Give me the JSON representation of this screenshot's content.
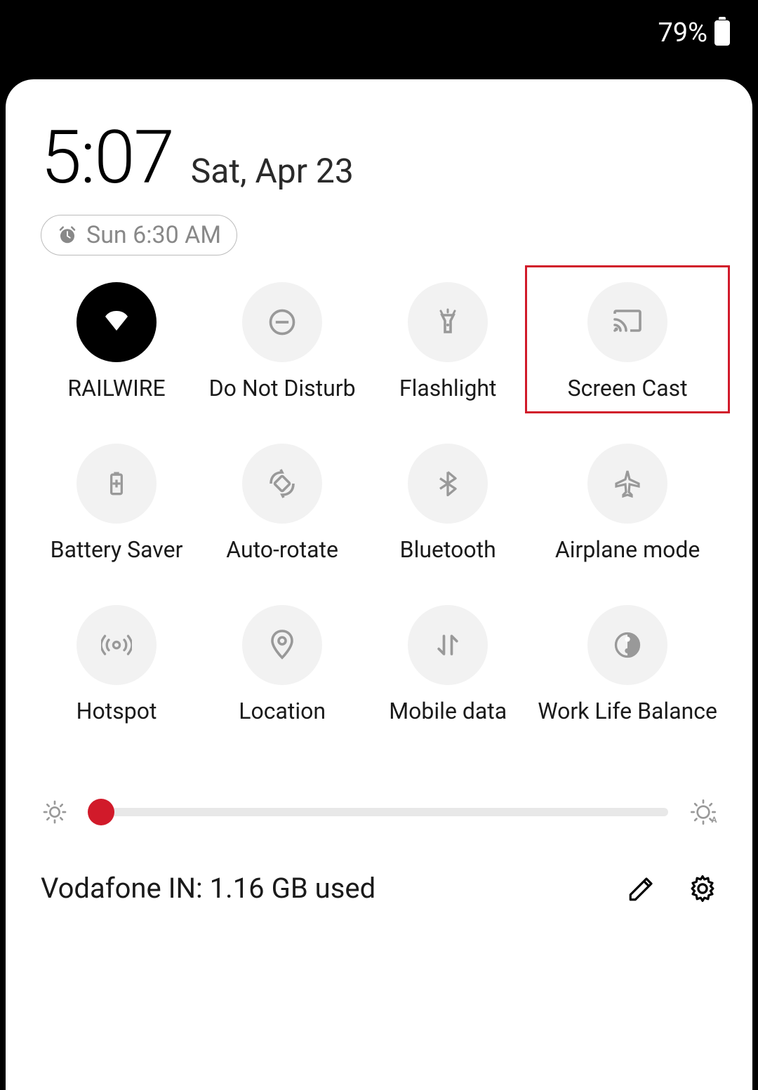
{
  "status": {
    "battery_percent": "79%"
  },
  "header": {
    "time": "5:07",
    "date": "Sat, Apr 23",
    "alarm": "Sun 6:30 AM"
  },
  "tiles": [
    {
      "label": "RAILWIRE",
      "icon": "wifi",
      "active": true
    },
    {
      "label": "Do Not Disturb",
      "icon": "dnd",
      "active": false
    },
    {
      "label": "Flashlight",
      "icon": "flashlight",
      "active": false
    },
    {
      "label": "Screen Cast",
      "icon": "cast",
      "active": false,
      "highlighted": true
    },
    {
      "label": "Battery Saver",
      "icon": "battery-saver",
      "active": false
    },
    {
      "label": "Auto-rotate",
      "icon": "auto-rotate",
      "active": false
    },
    {
      "label": "Bluetooth",
      "icon": "bluetooth",
      "active": false
    },
    {
      "label": "Airplane mode",
      "icon": "airplane",
      "active": false
    },
    {
      "label": "Hotspot",
      "icon": "hotspot",
      "active": false
    },
    {
      "label": "Location",
      "icon": "location",
      "active": false
    },
    {
      "label": "Mobile data",
      "icon": "mobile-data",
      "active": false
    },
    {
      "label": "Work Life Balance",
      "icon": "work-life",
      "active": false
    }
  ],
  "brightness": {
    "value_percent": 2
  },
  "footer": {
    "data_usage": "Vodafone IN: 1.16 GB used"
  }
}
